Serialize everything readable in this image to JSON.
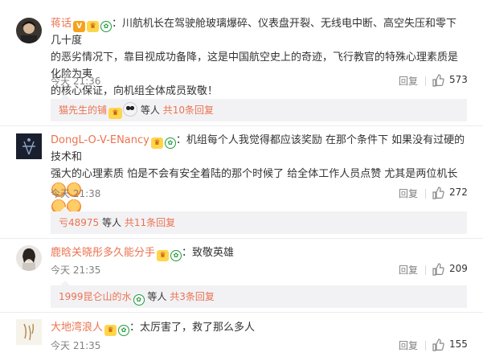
{
  "comments": [
    {
      "user": "蒋话",
      "text_lines": [
        "川航机长在驾驶舱玻璃爆碎、仪表盘开裂、无线电中断、高空失压和零下几十度",
        "的恶劣情况下，靠目视成功备降，这是中国航空史上的奇迹，飞行教官的特殊心理素质是化险为夷",
        "的核心保证，向机组全体成员致敬！"
      ],
      "time": "今天 21:36",
      "reply_label": "回复",
      "likes": "573",
      "sub": {
        "name": "猫先生的铺",
        "text": "等人",
        "count": "共10条回复"
      }
    },
    {
      "user": "DongL-O-V-ENancy",
      "text_lines": [
        "机组每个人我觉得都应该奖励 在那个条件下 如果没有过硬的技术和",
        "强大的心理素质 怕是不会有安全着陆的那个时候了 给全体工作人员点赞 尤其是两位机长"
      ],
      "time": "今天 21:38",
      "reply_label": "回复",
      "likes": "272",
      "sub": {
        "name": "亏48975",
        "text": "等人",
        "count": "共11条回复"
      }
    },
    {
      "user": "鹿晗关晓彤多久能分手",
      "text_lines": [
        "致敬英雄"
      ],
      "time": "今天 21:35",
      "reply_label": "回复",
      "likes": "209",
      "sub": {
        "name": "1999昆仑山的水",
        "text": "等人",
        "count": "共3条回复"
      }
    },
    {
      "user": "大地湾浪人",
      "text_lines": [
        "太厉害了，救了那么多人"
      ],
      "time": "今天 21:35",
      "reply_label": "回复",
      "likes": "155"
    }
  ],
  "colors": {
    "username": "#eb7350",
    "meta": "#808080",
    "subreply_bg": "#f2f2f5"
  },
  "icons": [
    "verified-v-icon",
    "crown-badge-icon",
    "green-member-icon",
    "fans-badge-icon",
    "thumbs-up-icon",
    "emoji-icon",
    "panda-emoji-icon"
  ]
}
